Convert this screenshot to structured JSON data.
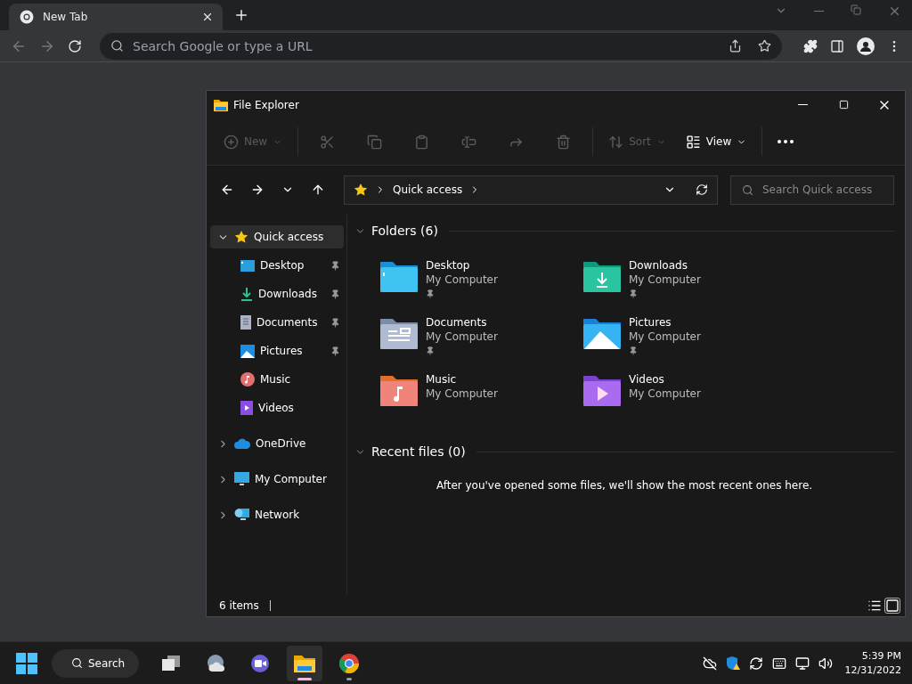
{
  "browser": {
    "tab": {
      "title": "New Tab"
    },
    "omnibox": {
      "placeholder": "Search Google or type a URL"
    }
  },
  "explorer": {
    "title": "File Explorer",
    "toolbar": [
      {
        "kind": "labeled",
        "label": "New",
        "disabled": true
      },
      {
        "kind": "icon",
        "disabled": true
      },
      {
        "kind": "icon",
        "disabled": true
      },
      {
        "kind": "icon",
        "disabled": true
      },
      {
        "kind": "icon",
        "disabled": true
      },
      {
        "kind": "icon",
        "disabled": true
      },
      {
        "kind": "icon",
        "disabled": true
      },
      {
        "kind": "labeled",
        "label": "Sort",
        "disabled": true
      },
      {
        "kind": "labeled",
        "label": "View",
        "disabled": false
      },
      {
        "kind": "more",
        "disabled": false
      }
    ],
    "address": {
      "crumbs": [
        "Quick access"
      ]
    },
    "search": {
      "placeholder": "Search Quick access"
    },
    "nav": [
      {
        "label": "Quick access",
        "expanded": true,
        "selected": true,
        "children": [
          {
            "label": "Desktop",
            "pinned": true,
            "selected": false
          },
          {
            "label": "Downloads",
            "pinned": true,
            "selected": false
          },
          {
            "label": "Documents",
            "pinned": true,
            "selected": false
          },
          {
            "label": "Pictures",
            "pinned": true,
            "selected": false
          },
          {
            "label": "Music",
            "pinned": false,
            "selected": false
          },
          {
            "label": "Videos",
            "pinned": false,
            "selected": false
          }
        ]
      },
      {
        "label": "OneDrive",
        "expanded": false,
        "selected": false
      },
      {
        "label": "My Computer",
        "expanded": false,
        "selected": false
      },
      {
        "label": "Network",
        "expanded": false,
        "selected": false
      }
    ],
    "folders": {
      "title": "Folders (6)",
      "expanded": true,
      "items": [
        {
          "name": "Desktop",
          "location": "My Computer",
          "pinned": true
        },
        {
          "name": "Downloads",
          "location": "My Computer",
          "pinned": true
        },
        {
          "name": "Documents",
          "location": "My Computer",
          "pinned": true
        },
        {
          "name": "Pictures",
          "location": "My Computer",
          "pinned": true
        },
        {
          "name": "Music",
          "location": "My Computer",
          "pinned": false
        },
        {
          "name": "Videos",
          "location": "My Computer",
          "pinned": false
        }
      ]
    },
    "recent": {
      "title": "Recent files (0)",
      "expanded": true,
      "message": "After you've opened some files, we'll show the most recent ones here."
    },
    "status": {
      "count": "6 items",
      "views": [
        {
          "selected": false
        },
        {
          "selected": true
        }
      ]
    }
  },
  "taskbar": {
    "search": "Search",
    "apps": [
      {
        "running": false,
        "selected": false
      },
      {
        "running": false,
        "selected": false
      },
      {
        "running": false,
        "selected": false
      },
      {
        "running": true,
        "selected": true
      },
      {
        "running": true,
        "selected": false
      }
    ],
    "time": "5:39 PM",
    "date": "12/31/2022"
  }
}
